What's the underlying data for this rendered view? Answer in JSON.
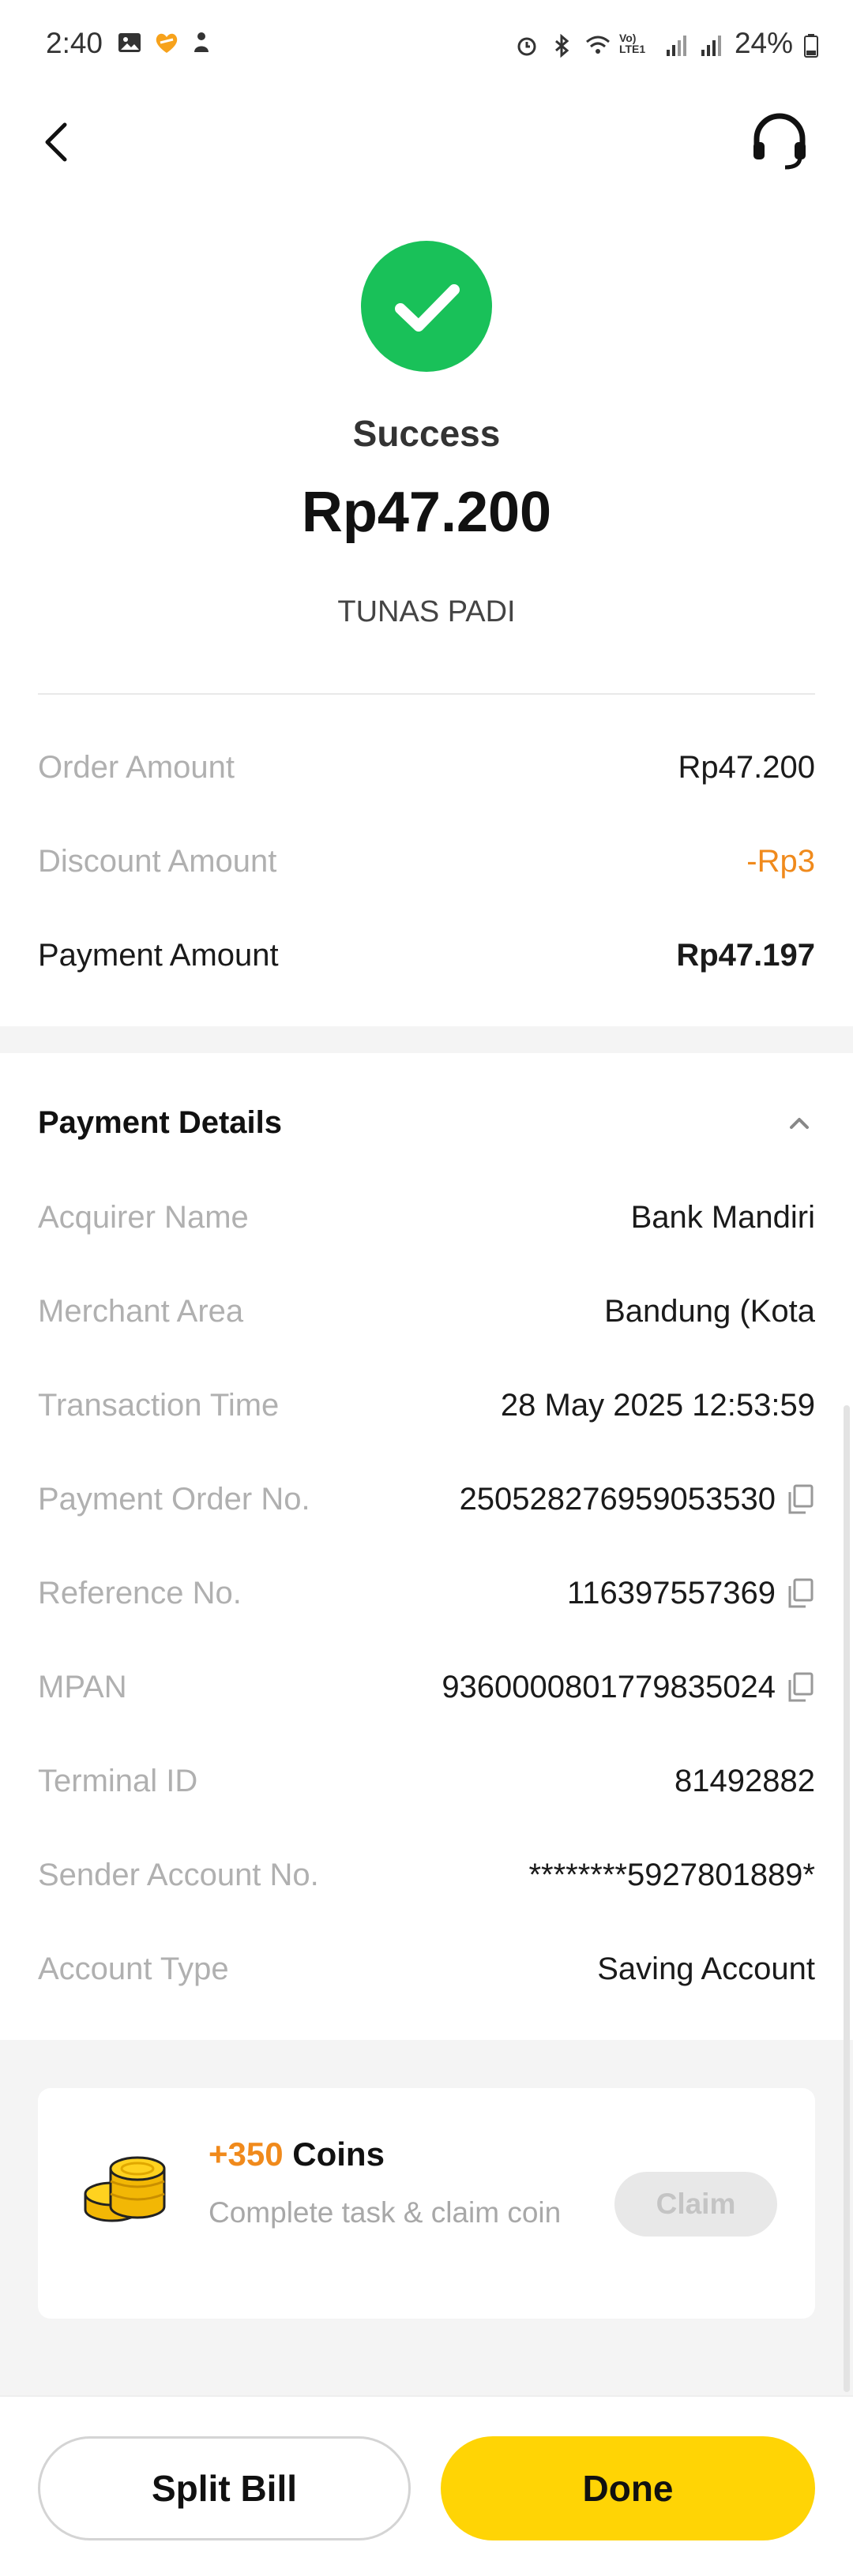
{
  "status_bar": {
    "time": "2:40",
    "battery": "24%",
    "network": "Vo) LTE1"
  },
  "header": {
    "back_icon": "chevron-left-icon",
    "support_icon": "headset-icon"
  },
  "result": {
    "status": "Success",
    "amount": "Rp47.200",
    "merchant": "TUNAS PADI"
  },
  "summary": [
    {
      "label": "Order Amount",
      "value": "Rp47.200"
    },
    {
      "label": "Discount Amount",
      "value": "-Rp3"
    },
    {
      "label": "Payment Amount",
      "value": "Rp47.197"
    }
  ],
  "payment_details": {
    "title": "Payment Details",
    "rows": [
      {
        "label": "Acquirer Name",
        "value": "Bank Mandiri"
      },
      {
        "label": "Merchant Area",
        "value": "Bandung (Kota"
      },
      {
        "label": "Transaction Time",
        "value": "28 May 2025 12:53:59"
      },
      {
        "label": "Payment Order No.",
        "value": "250528276959053530"
      },
      {
        "label": "Reference No.",
        "value": "116397557369"
      },
      {
        "label": "MPAN",
        "value": "9360000801779835024"
      },
      {
        "label": "Terminal ID",
        "value": "81492882"
      },
      {
        "label": "Sender Account No.",
        "value": "********5927801889*"
      },
      {
        "label": "Account Type",
        "value": "Saving Account"
      }
    ]
  },
  "coins": {
    "amount": "+350",
    "unit": "Coins",
    "subtitle": "Complete task & claim coin",
    "claim_label": "Claim"
  },
  "actions": {
    "split_label": "Split Bill",
    "done_label": "Done"
  },
  "colors": {
    "success_green": "#19c159",
    "accent_orange": "#f08a1c",
    "done_yellow": "#ffd405"
  }
}
